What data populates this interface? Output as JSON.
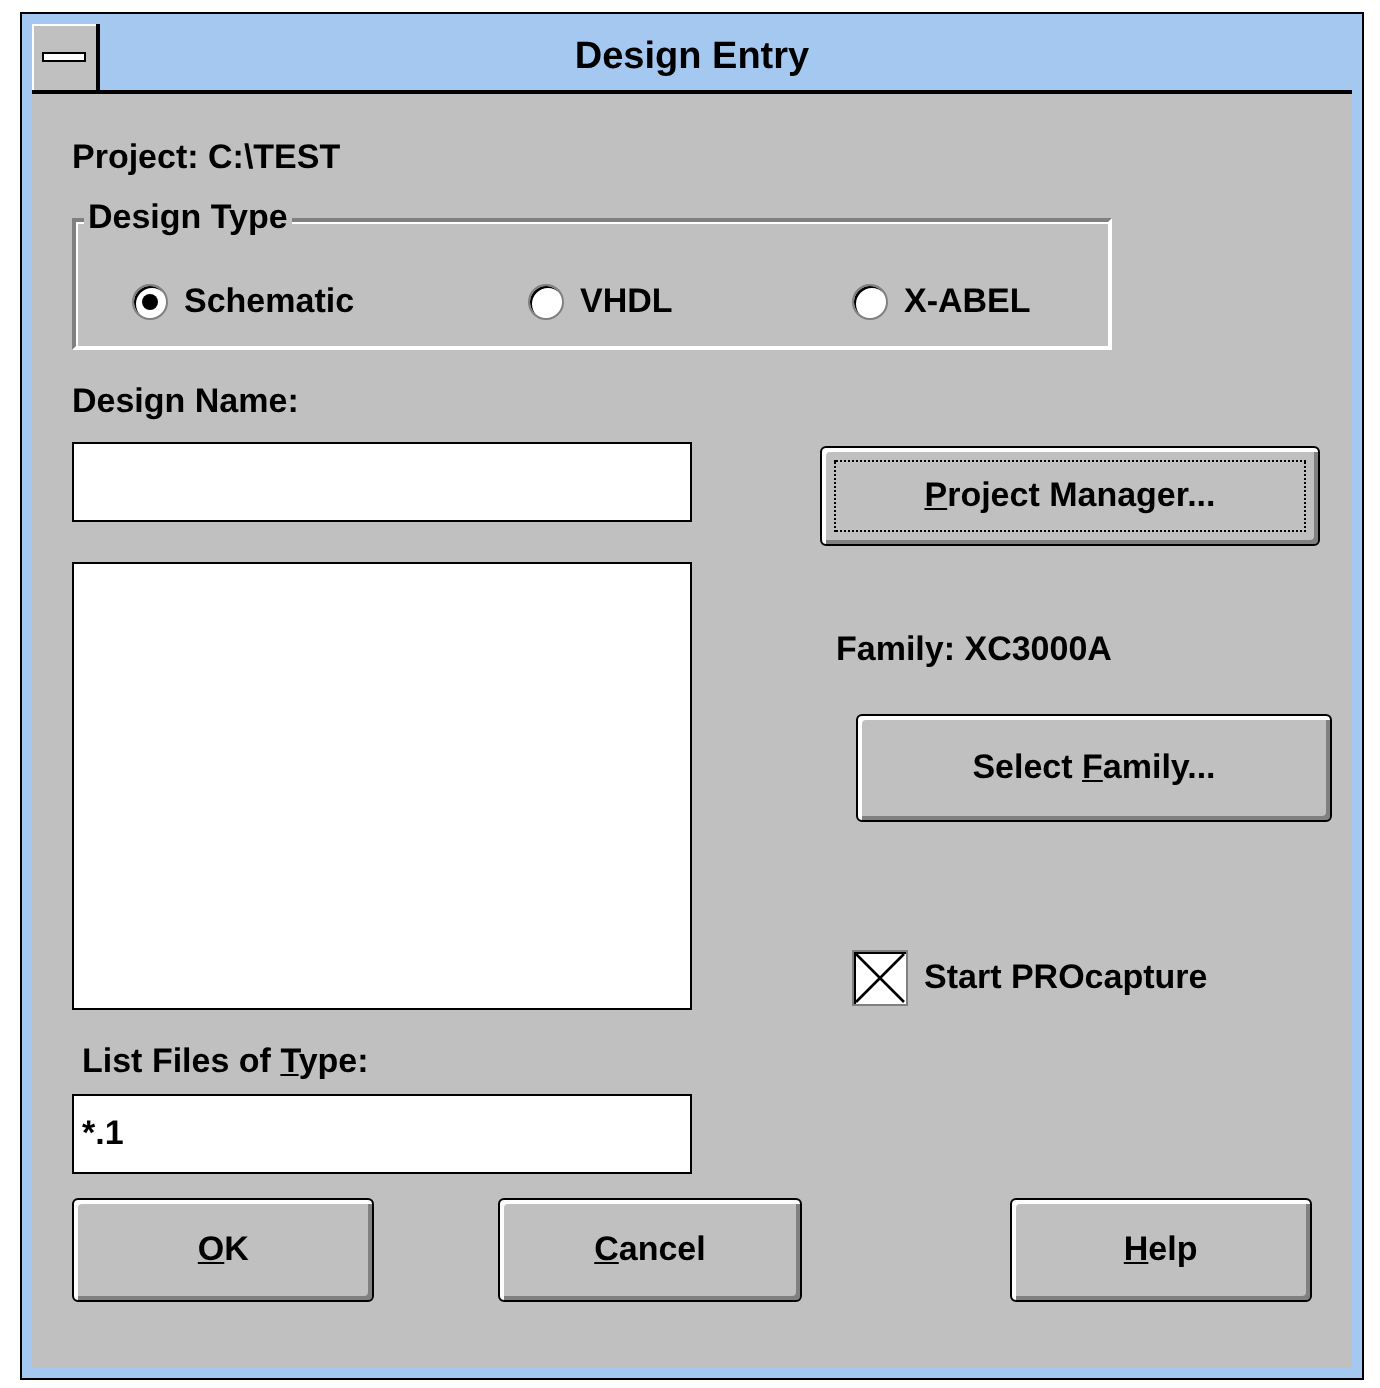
{
  "window": {
    "title": "Design Entry"
  },
  "project": "Project: C:\\TEST",
  "design_type": {
    "label": "Design Type",
    "options": [
      {
        "label": "Schematic",
        "selected": true
      },
      {
        "label": "VHDL",
        "selected": false
      },
      {
        "label": "X-ABEL",
        "selected": false
      }
    ]
  },
  "design_name": {
    "label": "Design Name:"
  },
  "project_manager_button": {
    "key": "P",
    "after": "roject Manager..."
  },
  "family": "Family: XC3000A",
  "select_family_button": {
    "before": "Select ",
    "key": "F",
    "after": "amily..."
  },
  "list_files": {
    "label": {
      "before": "List Files of ",
      "key": "T",
      "after": "ype:"
    },
    "value": "*.1"
  },
  "start_procapture": {
    "label": "Start PROcapture",
    "checked": true
  },
  "buttons": [
    {
      "key": "O",
      "after": "K"
    },
    {
      "key": "C",
      "after": "ancel"
    },
    {
      "key": "H",
      "after": "elp"
    }
  ]
}
